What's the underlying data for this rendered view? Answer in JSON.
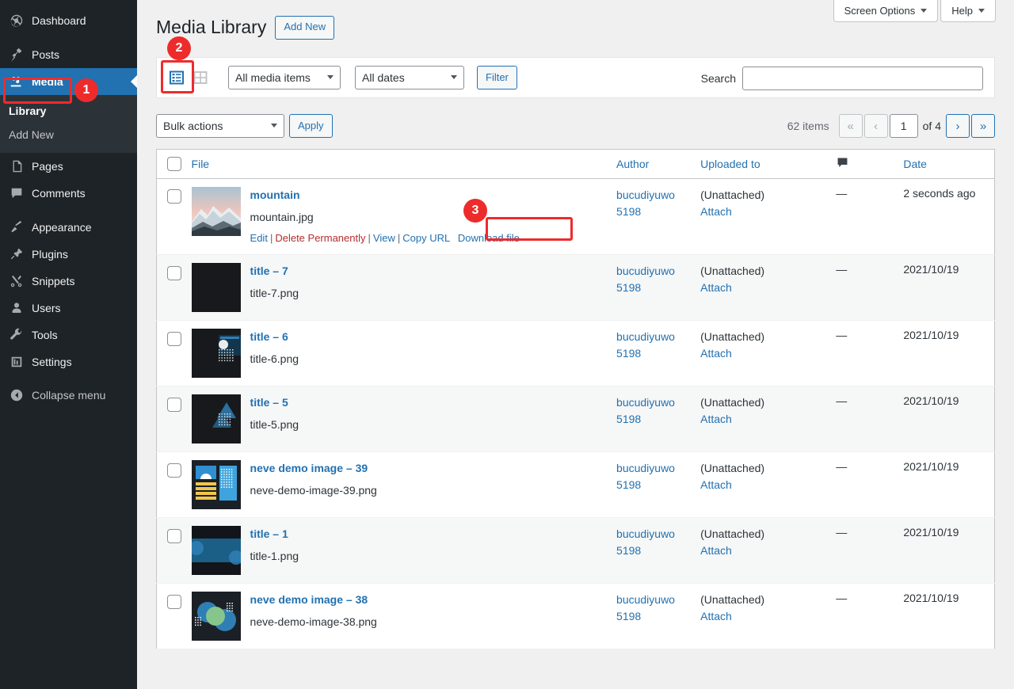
{
  "sidebar": {
    "items": [
      {
        "label": "Dashboard",
        "icon": "dashboard-icon",
        "name": "sidebar-item-dashboard"
      },
      {
        "label": "Posts",
        "icon": "pin-icon",
        "name": "sidebar-item-posts"
      },
      {
        "label": "Media",
        "icon": "media-icon",
        "name": "sidebar-item-media",
        "current": true
      },
      {
        "label": "Pages",
        "icon": "pages-icon",
        "name": "sidebar-item-pages"
      },
      {
        "label": "Comments",
        "icon": "comments-icon",
        "name": "sidebar-item-comments"
      },
      {
        "label": "Appearance",
        "icon": "brush-icon",
        "name": "sidebar-item-appearance"
      },
      {
        "label": "Plugins",
        "icon": "plugins-icon",
        "name": "sidebar-item-plugins"
      },
      {
        "label": "Snippets",
        "icon": "scissors-icon",
        "name": "sidebar-item-snippets"
      },
      {
        "label": "Users",
        "icon": "user-icon",
        "name": "sidebar-item-users"
      },
      {
        "label": "Tools",
        "icon": "wrench-icon",
        "name": "sidebar-item-tools"
      },
      {
        "label": "Settings",
        "icon": "settings-icon",
        "name": "sidebar-item-settings"
      }
    ],
    "submenu": [
      {
        "label": "Library",
        "current": true
      },
      {
        "label": "Add New",
        "current": false
      }
    ],
    "collapse_label": "Collapse menu",
    "collapse_icon": "collapse-arrow-icon",
    "active_color": "#2271b1"
  },
  "screen_meta": {
    "screen_options_label": "Screen Options",
    "help_label": "Help"
  },
  "header": {
    "title": "Media Library",
    "add_new_label": "Add New"
  },
  "toolbar": {
    "view_list_icon": "list-view-icon",
    "view_grid_icon": "grid-view-icon",
    "media_type_filter": "All media items",
    "date_filter": "All dates",
    "filter_label": "Filter"
  },
  "search": {
    "label": "Search",
    "value": "",
    "placeholder": ""
  },
  "bulk": {
    "action_value": "Bulk actions",
    "apply_label": "Apply"
  },
  "pagination": {
    "items_text": "62 items",
    "first_label": "«",
    "prev_label": "‹",
    "current_page": "1",
    "of_label": "of 4",
    "next_label": "›",
    "last_label": "»"
  },
  "table": {
    "columns": [
      {
        "key": "cb",
        "label": "",
        "name": "select-all-checkbox"
      },
      {
        "key": "file",
        "label": "File",
        "name": "column-header-file"
      },
      {
        "key": "author",
        "label": "Author",
        "name": "column-header-author"
      },
      {
        "key": "uploaded",
        "label": "Uploaded to",
        "name": "column-header-uploaded-to"
      },
      {
        "key": "comments",
        "label": "",
        "name": "column-header-comments"
      },
      {
        "key": "date",
        "label": "Date",
        "name": "column-header-date"
      }
    ],
    "row_actions": {
      "edit": "Edit",
      "delete": "Delete Permanently",
      "view": "View",
      "copy_url": "Copy URL",
      "download": "Download file"
    },
    "unattached_label": "(Unattached)",
    "attach_label": "Attach",
    "comment_dash": "—",
    "rows": [
      {
        "title": "mountain",
        "filename": "mountain.jpg",
        "author": "bucudiyuwo 5198",
        "uploaded_to": "(Unattached)",
        "comments": "—",
        "date": "2 seconds ago",
        "thumb": "mountain",
        "has_actions": true
      },
      {
        "title": "title – 7",
        "filename": "title-7.png",
        "author": "bucudiyuwo 5198",
        "uploaded_to": "(Unattached)",
        "comments": "—",
        "date": "2021/10/19",
        "thumb": "dark-plain",
        "has_actions": false
      },
      {
        "title": "title – 6",
        "filename": "title-6.png",
        "author": "bucudiyuwo 5198",
        "uploaded_to": "(Unattached)",
        "comments": "—",
        "date": "2021/10/19",
        "thumb": "dark-moon",
        "has_actions": false
      },
      {
        "title": "title – 5",
        "filename": "title-5.png",
        "author": "bucudiyuwo 5198",
        "uploaded_to": "(Unattached)",
        "comments": "—",
        "date": "2021/10/19",
        "thumb": "dark-triangles",
        "has_actions": false
      },
      {
        "title": "neve demo image – 39",
        "filename": "neve-demo-image-39.png",
        "author": "bucudiyuwo 5198",
        "uploaded_to": "(Unattached)",
        "comments": "—",
        "date": "2021/10/19",
        "thumb": "neve-39",
        "has_actions": false
      },
      {
        "title": "title – 1",
        "filename": "title-1.png",
        "author": "bucudiyuwo 5198",
        "uploaded_to": "(Unattached)",
        "comments": "—",
        "date": "2021/10/19",
        "thumb": "title-1",
        "has_actions": false
      },
      {
        "title": "neve demo image – 38",
        "filename": "neve-demo-image-38.png",
        "author": "bucudiyuwo 5198",
        "uploaded_to": "(Unattached)",
        "comments": "—",
        "date": "2021/10/19",
        "thumb": "neve-38",
        "has_actions": false
      }
    ]
  },
  "annotations": {
    "color": "#ee2b2b",
    "steps": [
      {
        "number": "1",
        "target": "sidebar-item-media"
      },
      {
        "number": "2",
        "target": "list-view-icon"
      },
      {
        "number": "3",
        "target": "download-file-link"
      }
    ]
  }
}
